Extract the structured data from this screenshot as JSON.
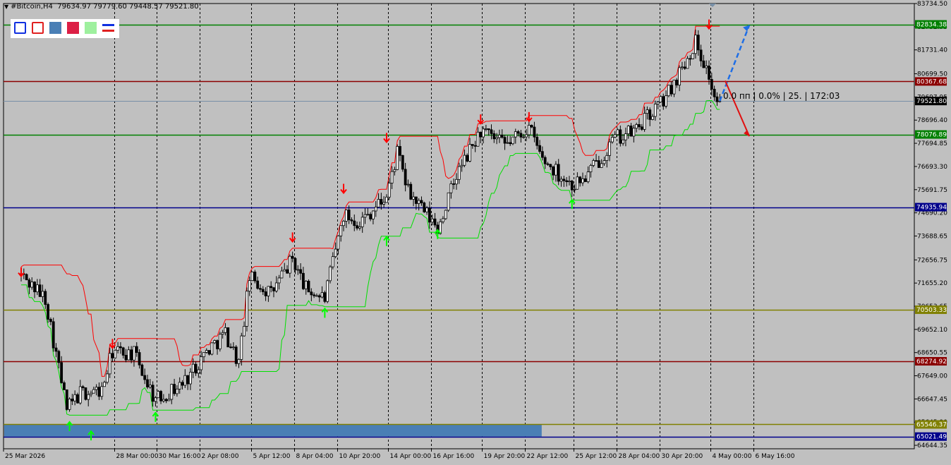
{
  "window": {
    "symbol_label": "#Bitcoin,H4",
    "ohlc": "79634.97 79779.60 79448.57 79521.80"
  },
  "toolbar": {
    "tools": [
      {
        "name": "rectangle-outline-blue-tool",
        "fill": "none",
        "stroke": "#1030e0"
      },
      {
        "name": "rectangle-outline-red-tool",
        "fill": "none",
        "stroke": "#e02020"
      },
      {
        "name": "rectangle-filled-steelblue-tool",
        "fill": "#4a7fb5",
        "stroke": "#4a7fb5"
      },
      {
        "name": "rectangle-filled-crimson-tool",
        "fill": "#dc1f45",
        "stroke": "#dc1f45"
      },
      {
        "name": "rectangle-filled-lightgreen-tool",
        "fill": "#9ef09e",
        "stroke": "#9ef09e"
      },
      {
        "name": "lines-tool",
        "fill": "none",
        "stroke": "#1030e0"
      }
    ]
  },
  "overlay_text": "0.0 пп | 0.0% | 25. | 172:03",
  "chart_data": {
    "type": "candlestick",
    "symbol": "#Bitcoin",
    "timeframe": "H4",
    "current_price": 79521.8,
    "ylim": [
      64494.35,
      83734.5
    ],
    "y_ticks": [
      83734.5,
      82732.95,
      81731.4,
      80699.5,
      79697.95,
      78696.4,
      77694.85,
      76693.3,
      75691.75,
      74690.2,
      73688.65,
      72656.75,
      71655.2,
      70653.65,
      69652.1,
      68650.55,
      67649.0,
      66647.45,
      65645.9,
      64644.35
    ],
    "x_labels": [
      "25 Mar 2026",
      "28 Mar 00:00",
      "30 Mar 16:00",
      "2 Apr 08:00",
      "5 Apr 12:00",
      "8 Apr 04:00",
      "10 Apr 20:00",
      "14 Apr 00:00",
      "16 Apr 16:00",
      "19 Apr 20:00",
      "22 Apr 12:00",
      "25 Apr 12:00",
      "28 Apr 04:00",
      "30 Apr 20:00",
      "4 May 00:00",
      "6 May 16:00"
    ],
    "horizontal_levels": [
      {
        "price": 82834.38,
        "label": "82834.38",
        "color": "#008000"
      },
      {
        "price": 80367.68,
        "label": "80367.68",
        "color": "#8b0000"
      },
      {
        "price": 79521.8,
        "label": "79521.80",
        "color": "#000000"
      },
      {
        "price": 78076.89,
        "label": "78076.89",
        "color": "#008000"
      },
      {
        "price": 74935.94,
        "label": "74935.94",
        "color": "#00008b"
      },
      {
        "price": 70503.33,
        "label": "70503.33",
        "color": "#808000"
      },
      {
        "price": 68274.92,
        "label": "68274.92",
        "color": "#8b0000"
      },
      {
        "price": 65546.37,
        "label": "65546.37",
        "color": "#808000"
      },
      {
        "price": 65021.49,
        "label": "65021.49",
        "color": "#00008b"
      }
    ],
    "zone": {
      "from_price": 65546.37,
      "to_price": 65021.49,
      "color": "#4a7fb5",
      "end_label": "25 Apr 12:00"
    },
    "waypoints": [
      [
        "25 Mar 2026",
        72000
      ],
      [
        "26 Mar 12:00",
        71000
      ],
      [
        "27 Mar 20:00",
        66200
      ],
      [
        "28 Mar 16:00",
        66900
      ],
      [
        "30 Mar 00:00",
        67000
      ],
      [
        "30 Mar 16:00",
        68700
      ],
      [
        "1 Apr 00:00",
        68600
      ],
      [
        "2 Apr 08:00",
        66600
      ],
      [
        "4 Apr 00:00",
        67300
      ],
      [
        "5 Apr 12:00",
        68700
      ],
      [
        "6 Apr 16:00",
        69500
      ],
      [
        "7 Apr 12:00",
        68200
      ],
      [
        "8 Apr 04:00",
        71900
      ],
      [
        "9 Apr 12:00",
        71200
      ],
      [
        "10 Apr 20:00",
        72700
      ],
      [
        "11 Apr 16:00",
        71400
      ],
      [
        "12 Apr 20:00",
        71000
      ],
      [
        "14 Apr 00:00",
        74600
      ],
      [
        "15 Apr 00:00",
        74300
      ],
      [
        "16 Apr 16:00",
        75400
      ],
      [
        "17 Apr 08:00",
        77300
      ],
      [
        "18 Apr 00:00",
        75600
      ],
      [
        "19 Apr 20:00",
        74000
      ],
      [
        "21 Apr 00:00",
        76300
      ],
      [
        "22 Apr 12:00",
        78200
      ],
      [
        "24 Apr 00:00",
        77600
      ],
      [
        "25 Apr 12:00",
        78400
      ],
      [
        "26 Apr 08:00",
        77000
      ],
      [
        "28 Apr 04:00",
        75900
      ],
      [
        "29 Apr 00:00",
        76200
      ],
      [
        "30 Apr 20:00",
        77900
      ],
      [
        "2 May 00:00",
        78200
      ],
      [
        "4 May 00:00",
        79700
      ],
      [
        "5 May 04:00",
        81200
      ],
      [
        "5 May 20:00",
        82100
      ],
      [
        "6 May 16:00",
        80600
      ],
      [
        "7 May 00:00",
        79600
      ],
      [
        "7 May 08:00",
        79521.8
      ]
    ],
    "fractal_up_arrows": [
      [
        "25 Mar 2026",
        72100
      ],
      [
        "30 Mar 16:00",
        69000
      ],
      [
        "10 Apr 20:00",
        73600
      ],
      [
        "14 Apr 00:00",
        75700
      ],
      [
        "16 Apr 16:00",
        77900
      ],
      [
        "22 Apr 12:00",
        78700
      ],
      [
        "25 Apr 12:00",
        78800
      ],
      [
        "6 May 16:00",
        82800
      ]
    ],
    "fractal_down_arrows": [
      [
        "28 Mar 00:00",
        65500
      ],
      [
        "29 Mar 08:00",
        65100
      ],
      [
        "2 Apr 08:00",
        65900
      ],
      [
        "12 Apr 20:00",
        70400
      ],
      [
        "16 Apr 16:00",
        73500
      ],
      [
        "19 Apr 20:00",
        73800
      ],
      [
        "28 Apr 04:00",
        75100
      ]
    ],
    "projection_up": {
      "from": [
        "7 May 08:00",
        79521.8
      ],
      "to": [
        "9 May 04:00",
        82800
      ],
      "color": "#1e6ee6"
    },
    "projection_down": {
      "from": [
        "7 May 16:00",
        80400
      ],
      "to": [
        "9 May 04:00",
        78000
      ],
      "color": "#e01010"
    }
  }
}
